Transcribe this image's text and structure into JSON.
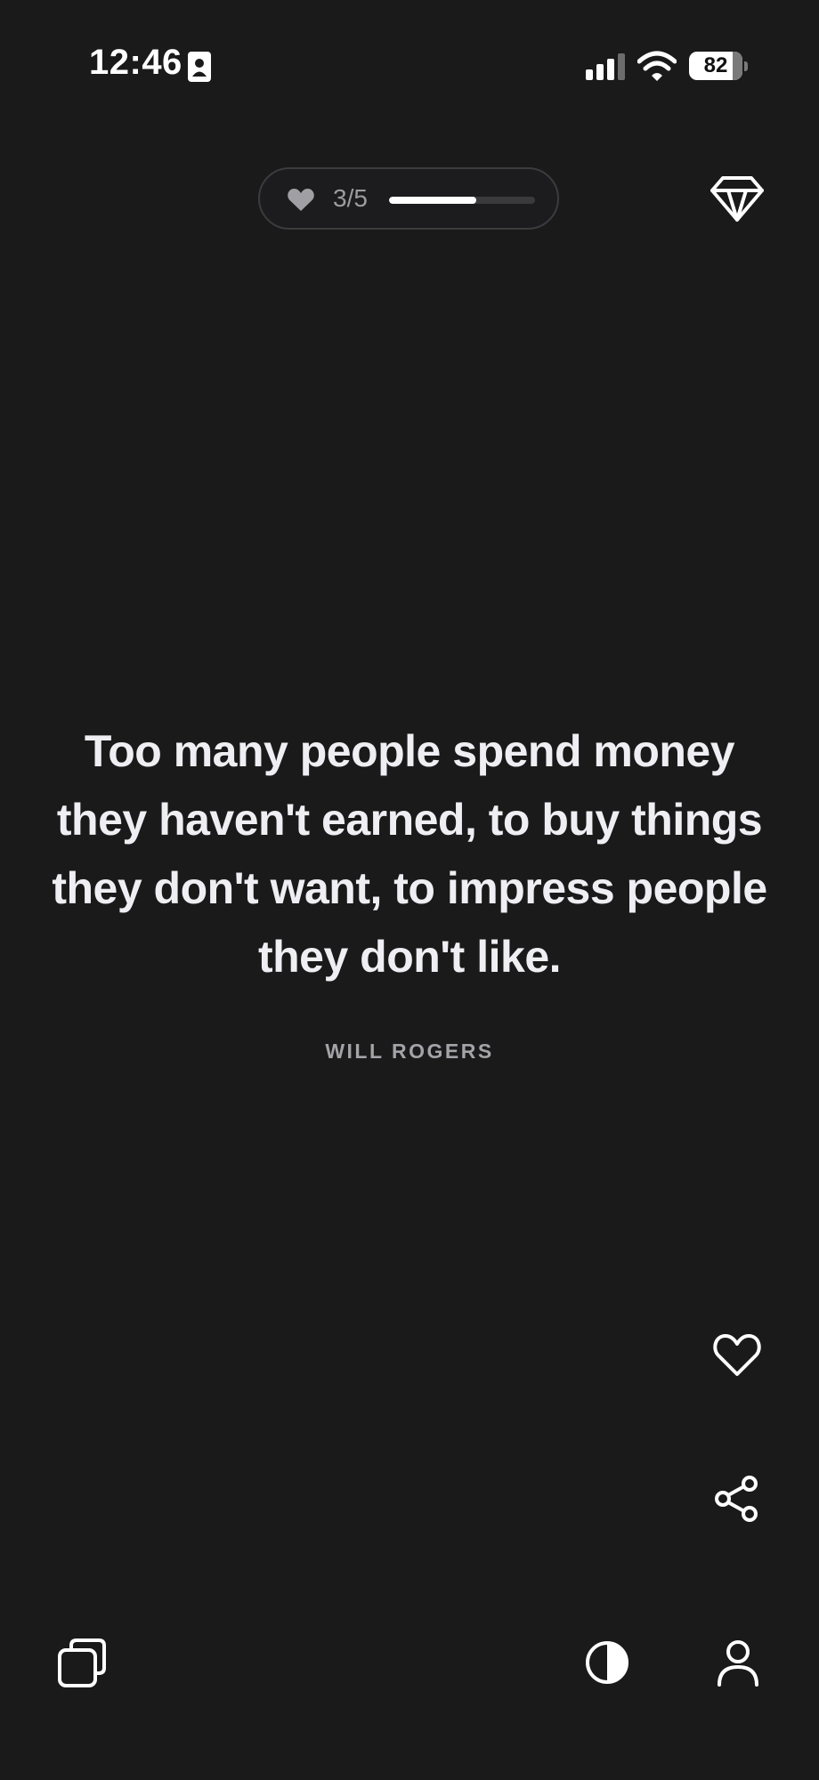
{
  "status_bar": {
    "time": "12:46",
    "battery_level": "82",
    "icons": [
      "contact-card-icon",
      "signal-icon",
      "wifi-icon",
      "battery-icon"
    ]
  },
  "streak": {
    "count_label": "3/5",
    "progress": 0.6,
    "icon": "heart-icon"
  },
  "premium": {
    "icon": "diamond-icon"
  },
  "quote": {
    "text": "Too many people spend money they haven't earned, to buy things they don't want, to impress people they don't like.",
    "author": "WILL ROGERS"
  },
  "actions": {
    "like_icon": "heart-outline-icon",
    "share_icon": "share-icon"
  },
  "bottom_bar": {
    "left_icon": "collections-icon",
    "theme_icon": "contrast-icon",
    "profile_icon": "person-icon"
  },
  "colors": {
    "background": "#1a1a1a",
    "text": "#eeeef3",
    "muted": "#a3a3a8",
    "pill_border": "#3c3c3e"
  }
}
